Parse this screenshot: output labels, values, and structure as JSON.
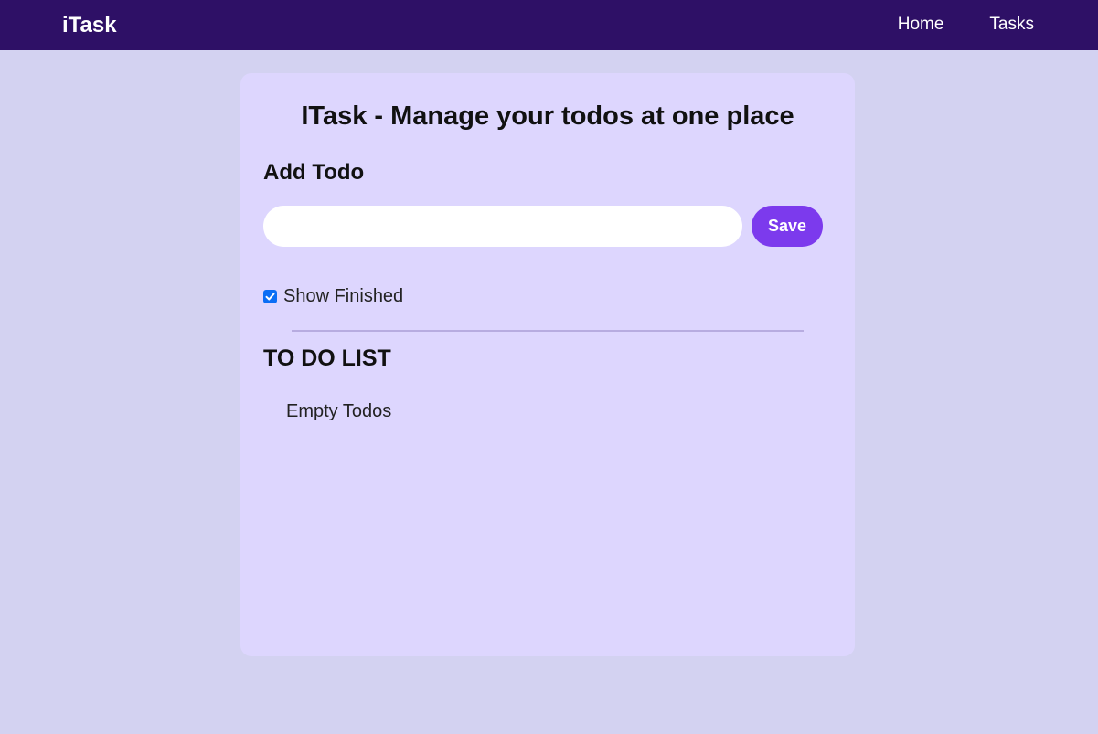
{
  "navbar": {
    "brand": "iTask",
    "links": [
      "Home",
      "Tasks"
    ],
    "background": "#2e1066"
  },
  "main": {
    "title": "ITask - Manage your todos at one place",
    "add_heading": "Add Todo",
    "todo_input": {
      "value": "",
      "placeholder": ""
    },
    "save_label": "Save",
    "show_finished": {
      "label": "Show Finished",
      "checked": true
    },
    "list_heading": "TO DO LIST",
    "empty_message": "Empty Todos",
    "todos": []
  },
  "colors": {
    "page_background": "#d3d2f1",
    "card_background": "#ddd6fe",
    "accent": "#7c3aed",
    "checkbox": "#0b6ef5"
  }
}
